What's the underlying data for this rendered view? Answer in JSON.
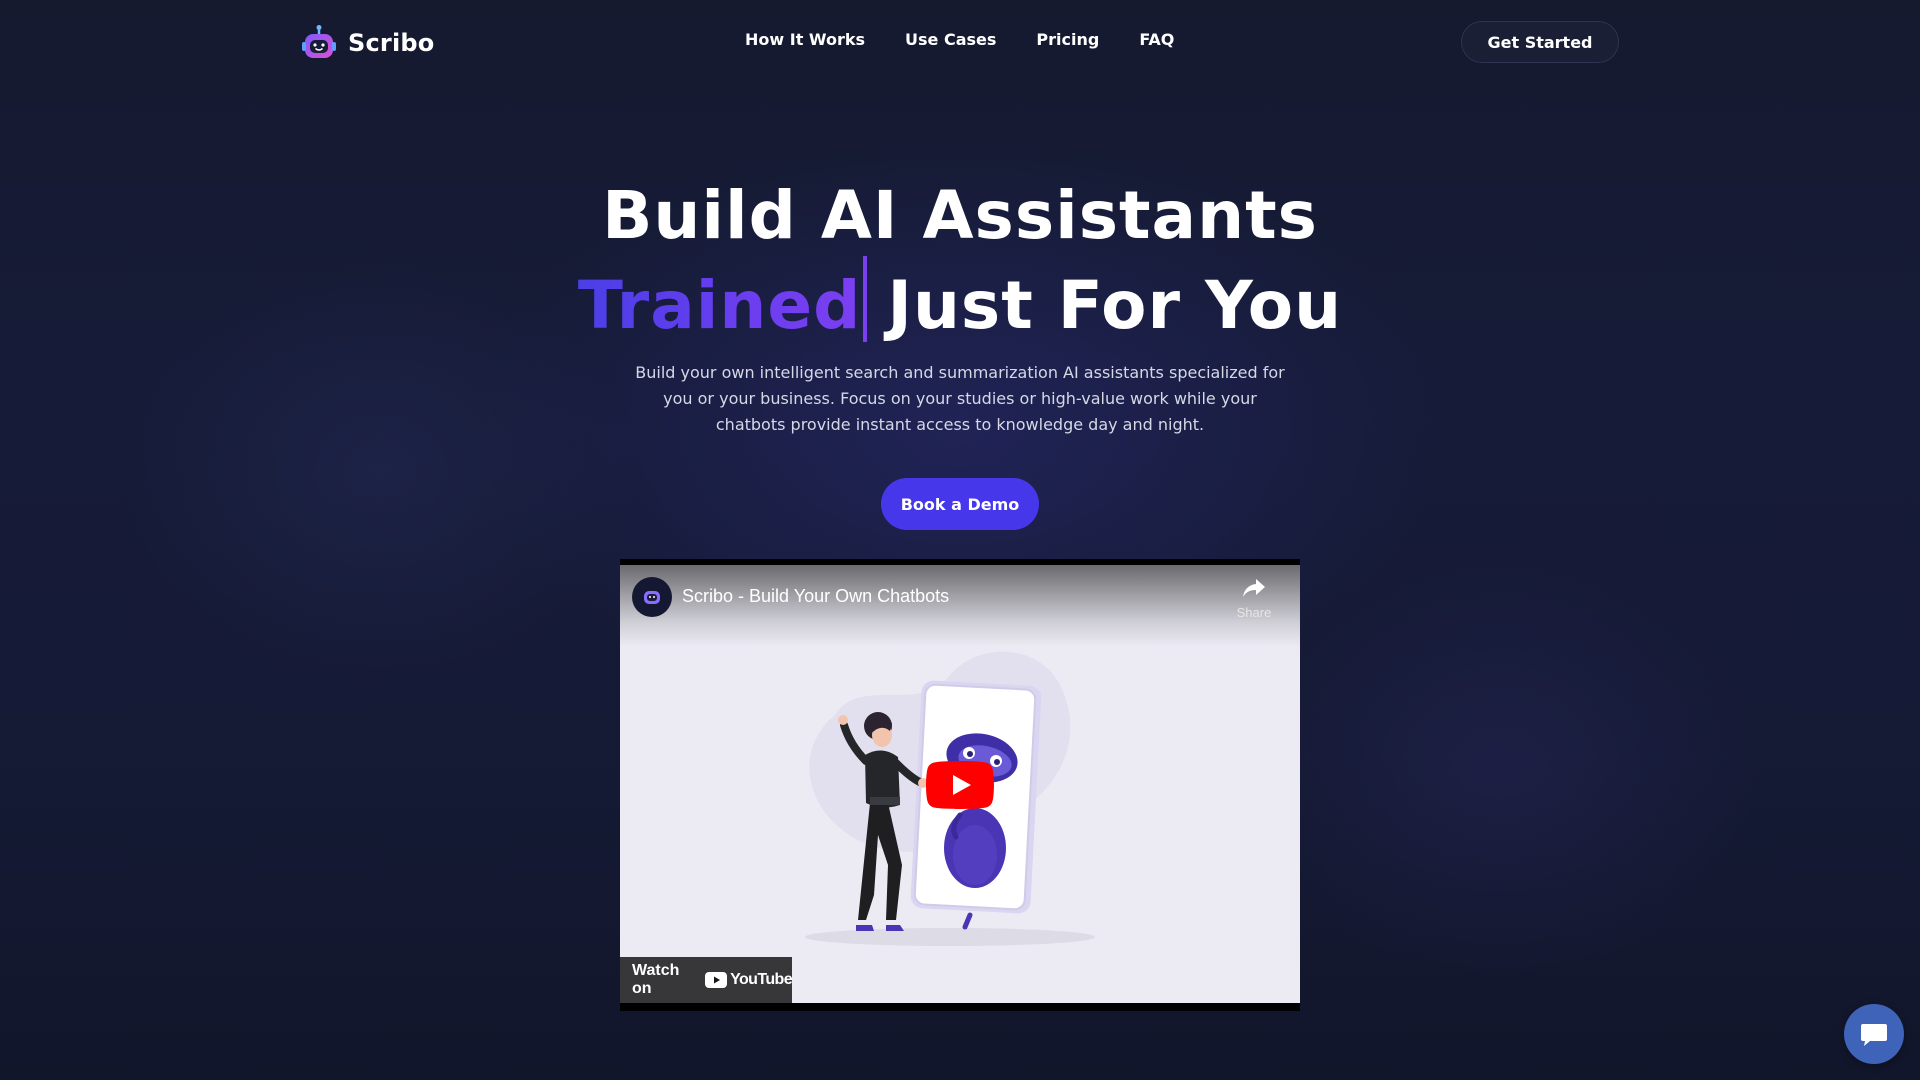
{
  "brand": {
    "name": "Scribo",
    "logo_icon": "robot-logo-icon"
  },
  "nav": {
    "links": [
      "How It Works",
      "Use Cases",
      "Pricing",
      "FAQ"
    ],
    "cta_label": "Get Started"
  },
  "hero": {
    "title_line1": "Build AI Assistants",
    "title_accent": "Trained",
    "title_rest": "Just For You",
    "subtitle": "Build your own intelligent search and summarization AI assistants specialized for you or your business. Focus on your studies or high-value work while your chatbots provide instant access to knowledge day and night.",
    "demo_label": "Book a Demo"
  },
  "video": {
    "title": "Scribo - Build Your Own Chatbots",
    "share_label": "Share",
    "watch_label": "Watch on",
    "youtube_word": "YouTube"
  },
  "colors": {
    "background": "#141831",
    "accent_gradient_start": "#4a3fe6",
    "accent_gradient_end": "#7b3ff0",
    "demo_button": "#4637ea",
    "chat_button": "#3f63b8",
    "youtube_red": "#ff0000"
  },
  "icons": {
    "share": "share-arrow-icon",
    "play": "play-icon",
    "chat": "chat-bubble-icon"
  }
}
